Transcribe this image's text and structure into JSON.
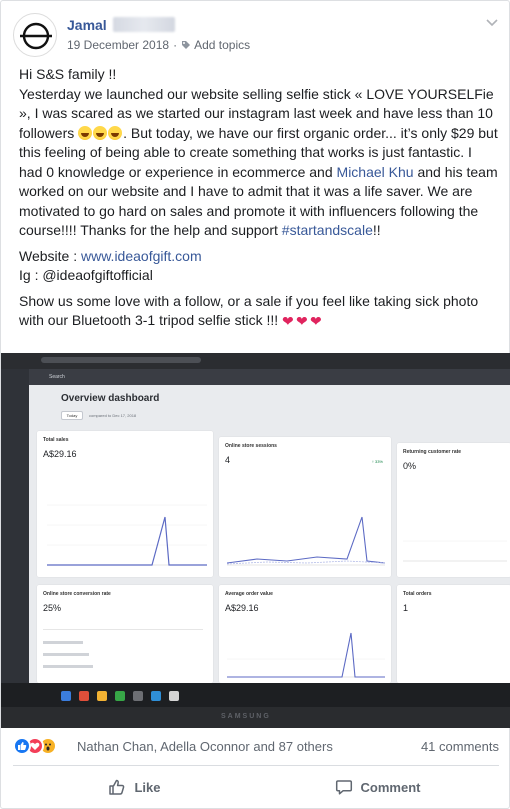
{
  "post": {
    "author": "Jamal",
    "date": "19 December 2018",
    "add_topics": "Add topics",
    "greeting": "Hi S&S family !!",
    "para1_a": "Yesterday we launched our website selling selfie stick « LOVE YOURSELFie », I was scared as we started our instagram last week and have less than 10 followers ",
    "para1_b": ". But today, we have our first organic order... it’s only $29 but this feeling of being able to create something that works is just fantastic. I had 0 knowledge or experience in ecommerce and ",
    "mention": "Michael Khu",
    "para1_c": " and his team worked on our website and I have to admit that it was a life saver. We are motivated to go hard on sales and promote it with influencers following the course!!!! Thanks for the help and support ",
    "hashtag": "#startandscale",
    "para1_d": "!!",
    "website_label": "Website : ",
    "website_link": "www.ideaofgift.com",
    "ig_label": "Ig : @ideaofgiftofficial",
    "para2": "Show us some love with a follow, or a sale if you feel like taking sick photo with our Bluetooth 3-1 tripod selfie stick !!! "
  },
  "photo": {
    "search": "Search",
    "dashboard_title": "Overview dashboard",
    "today": "Today",
    "compared": "compared to Dec 17, 2018",
    "total_sales_label": "Total sales",
    "total_sales_value": "A$29.16",
    "sessions_label": "Online store sessions",
    "sessions_value": "4",
    "sessions_change": "↑ 33%",
    "returning_label": "Returning customer rate",
    "returning_value": "0%",
    "conversion_label": "Online store conversion rate",
    "conversion_value": "25%",
    "aov_label": "Average order value",
    "aov_value": "A$29.16",
    "orders_label": "Total orders",
    "orders_value": "1",
    "brand": "SAMSUNG"
  },
  "reactions": {
    "names": "Nathan Chan, Adella Oconnor and 87 others",
    "comments": "41 comments"
  },
  "actions": {
    "like": "Like",
    "comment": "Comment"
  },
  "colors": {
    "link": "#385898",
    "like_blue": "#1877f2",
    "love_red": "#f33e58",
    "wow_yellow": "#f7b125"
  }
}
